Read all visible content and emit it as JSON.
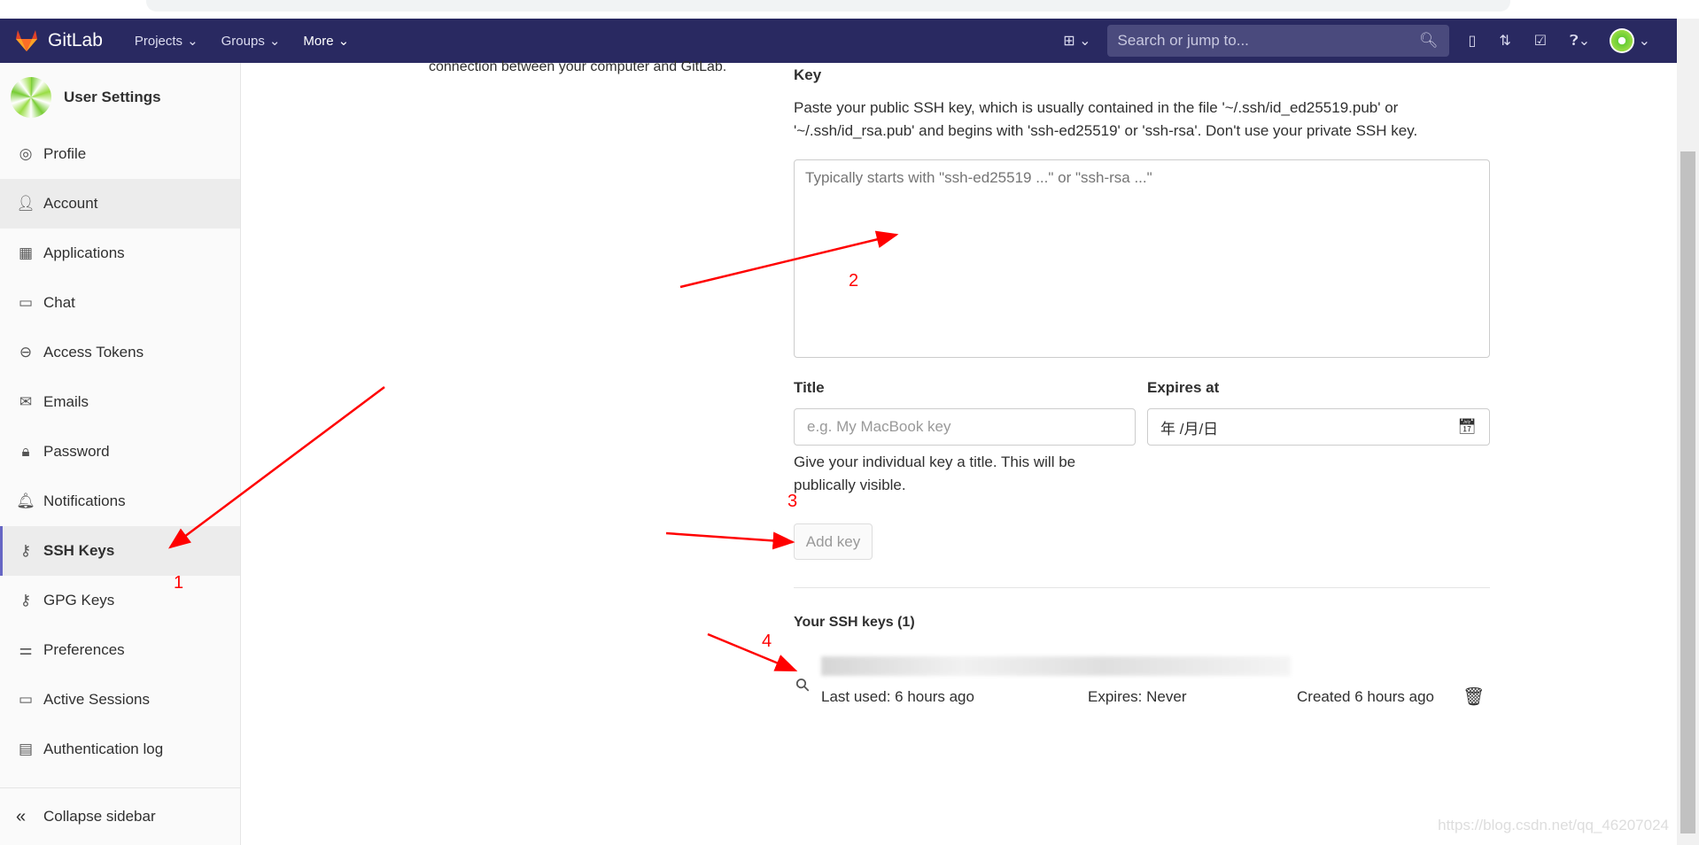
{
  "nav": {
    "brand": "GitLab",
    "links": [
      "Projects",
      "Groups",
      "More"
    ],
    "search_placeholder": "Search or jump to..."
  },
  "sidebar": {
    "title": "User Settings",
    "items": [
      {
        "label": "Profile",
        "icon": "user-circle-icon"
      },
      {
        "label": "Account",
        "icon": "account-icon"
      },
      {
        "label": "Applications",
        "icon": "grid-icon"
      },
      {
        "label": "Chat",
        "icon": "comment-icon"
      },
      {
        "label": "Access Tokens",
        "icon": "token-icon"
      },
      {
        "label": "Emails",
        "icon": "envelope-icon"
      },
      {
        "label": "Password",
        "icon": "lock-icon"
      },
      {
        "label": "Notifications",
        "icon": "bell-icon"
      },
      {
        "label": "SSH Keys",
        "icon": "key-icon"
      },
      {
        "label": "GPG Keys",
        "icon": "key-icon"
      },
      {
        "label": "Preferences",
        "icon": "sliders-icon"
      },
      {
        "label": "Active Sessions",
        "icon": "monitor-icon"
      },
      {
        "label": "Authentication log",
        "icon": "log-icon"
      }
    ],
    "active": "SSH Keys",
    "collapse": "Collapse sidebar"
  },
  "main": {
    "intro": "connection between your computer and GitLab.",
    "key_label": "Key",
    "key_help_1": "Paste your public SSH key, which is usually contained in the file '~/.ssh/id_ed25519.pub' or",
    "key_help_2": "'~/.ssh/id_rsa.pub' and begins with 'ssh-ed25519' or 'ssh-rsa'. Don't use your private SSH key.",
    "key_placeholder": "Typically starts with \"ssh-ed25519 ...\" or \"ssh-rsa ...\"",
    "title_label": "Title",
    "title_placeholder": "e.g. My MacBook key",
    "title_help_1": "Give your individual key a title. This will be",
    "title_help_2": "publically visible.",
    "expires_label": "Expires at",
    "expires_value": "年 /月/日",
    "add_key": "Add key",
    "keys_heading": "Your SSH keys (1)",
    "key_row": {
      "last_used": "Last used: 6 hours ago",
      "expires": "Expires: Never",
      "created": "Created 6 hours ago"
    }
  },
  "annotations": [
    "1",
    "2",
    "3",
    "4"
  ],
  "annotation_color": "#ff0000",
  "watermark": "https://blog.csdn.net/qq_46207024"
}
